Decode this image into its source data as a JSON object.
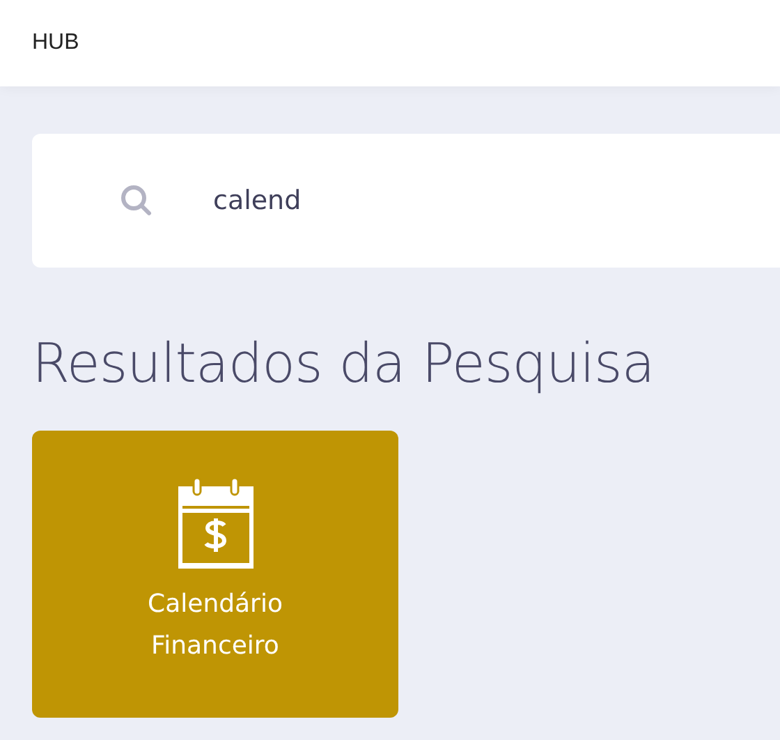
{
  "header": {
    "title": "HUB"
  },
  "search": {
    "value": "calend"
  },
  "results": {
    "title": "Resultados da Pesquisa",
    "items": [
      {
        "label_lines": [
          "Calendário",
          "Financeiro"
        ]
      }
    ]
  }
}
